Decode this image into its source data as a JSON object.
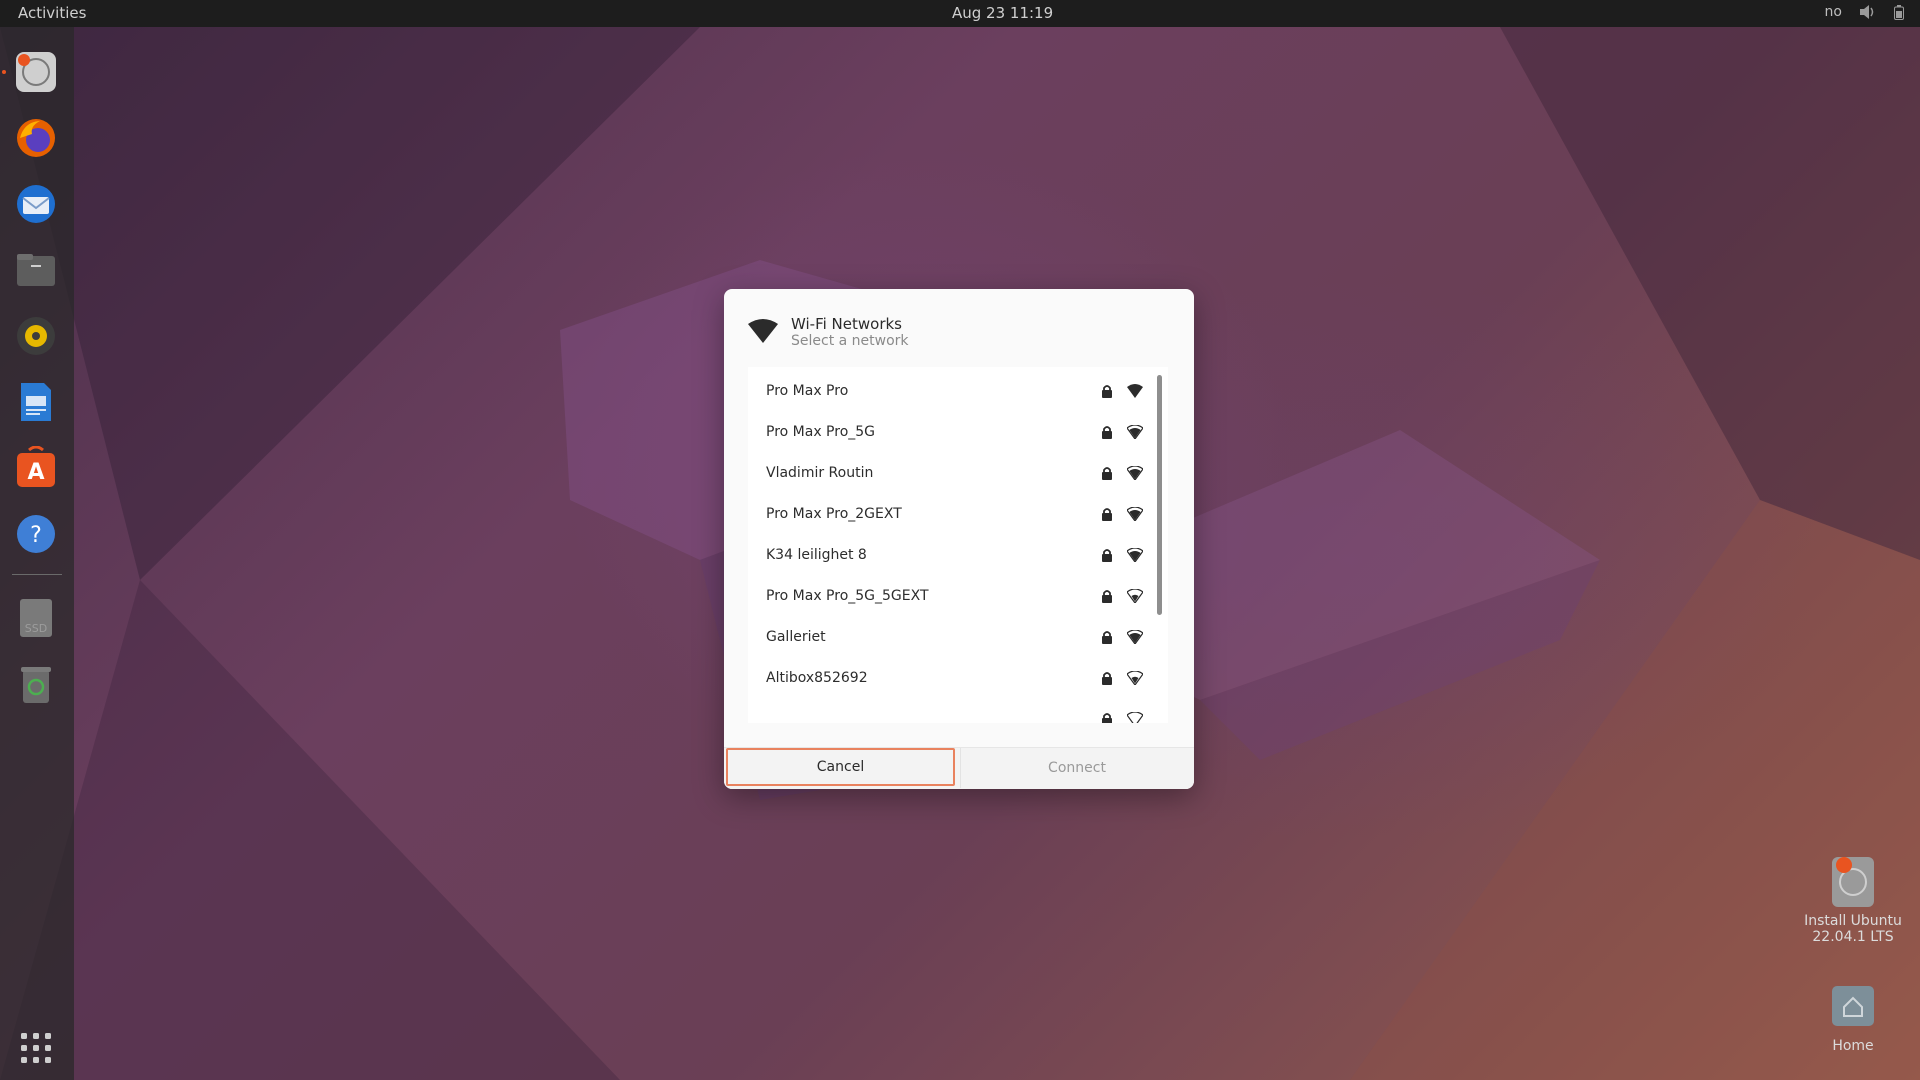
{
  "topbar": {
    "activities": "Activities",
    "clock": "Aug 23  11:19",
    "keyboard_layout": "no",
    "icons": [
      "volume-icon",
      "battery-icon"
    ]
  },
  "dock": {
    "items": [
      {
        "name": "ubuntu-installer-icon",
        "active": true
      },
      {
        "name": "firefox-icon"
      },
      {
        "name": "thunderbird-icon"
      },
      {
        "name": "files-icon"
      },
      {
        "name": "rhythmbox-icon"
      },
      {
        "name": "libreoffice-writer-icon"
      },
      {
        "name": "app-center-icon"
      },
      {
        "name": "help-icon"
      },
      {
        "name": "drive-icon",
        "label": "SSD"
      },
      {
        "name": "trash-icon"
      },
      {
        "name": "show-apps-icon"
      }
    ]
  },
  "desktop": {
    "install": {
      "label_line1": "Install Ubuntu",
      "label_line2": "22.04.1 LTS"
    },
    "home": {
      "label": "Home"
    }
  },
  "dialog": {
    "title": "Wi-Fi Networks",
    "subtitle": "Select a network",
    "networks": [
      {
        "name": "Pro Max Pro",
        "secured": true,
        "signal": "full"
      },
      {
        "name": "Pro Max Pro_5G",
        "secured": true,
        "signal": "good"
      },
      {
        "name": "Vladimir Routin",
        "secured": true,
        "signal": "good"
      },
      {
        "name": "Pro Max Pro_2GEXT",
        "secured": true,
        "signal": "good"
      },
      {
        "name": "K34 leilighet 8",
        "secured": true,
        "signal": "good"
      },
      {
        "name": "Pro Max Pro_5G_5GEXT",
        "secured": true,
        "signal": "ok"
      },
      {
        "name": "Galleriet",
        "secured": true,
        "signal": "good"
      },
      {
        "name": "Altibox852692",
        "secured": true,
        "signal": "ok"
      }
    ],
    "cancel_label": "Cancel",
    "connect_label": "Connect"
  },
  "colors": {
    "accent": "#e95420",
    "focus_border": "#e9825e",
    "topbar": "#1d1d1d"
  }
}
